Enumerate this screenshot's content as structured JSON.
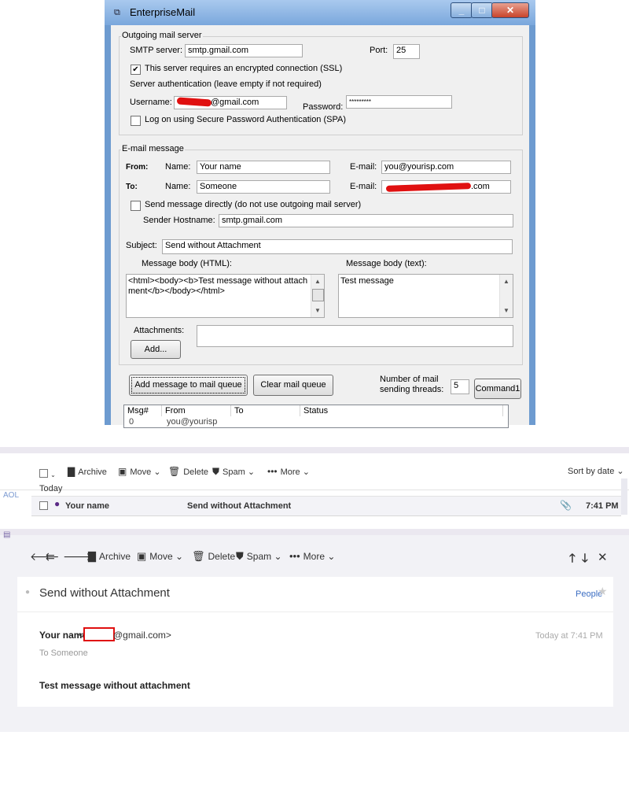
{
  "dialog": {
    "title": "EnterpriseMail",
    "outgoing": {
      "group_title": "Outgoing mail server",
      "smtp_label": "SMTP server:",
      "smtp_value": "smtp.gmail.com",
      "port_label": "Port:",
      "port_value": "25",
      "ssl_label": "This server requires an encrypted connection (SSL)",
      "ssl_checked": true,
      "auth_label": "Server authentication (leave empty if not required)",
      "username_label": "Username:",
      "username_value": "@gmail.com",
      "password_label": "Password:",
      "password_value": "*********",
      "spa_label": "Log on using Secure Password Authentication (SPA)"
    },
    "email": {
      "group_title": "E-mail message",
      "from_label": "From:",
      "to_label": "To:",
      "name_label": "Name:",
      "email_label": "E-mail:",
      "from_name": "Your name",
      "from_email": "you@yourisp.com",
      "to_name": "Someone",
      "to_email": ".com",
      "direct_label": "Send message directly (do not use outgoing mail server)",
      "hostname_label": "Sender Hostname:",
      "hostname_value": "smtp.gmail.com",
      "subject_label": "Subject:",
      "subject_value": "Send without Attachment",
      "html_body_label": "Message body (HTML):",
      "html_body_value": "<html><body><b>Test message without attachment</b></body></html>",
      "text_body_label": "Message body (text):",
      "text_body_value": "Test message",
      "attachments_label": "Attachments:",
      "add_button": "Add..."
    },
    "queue": {
      "add_button": "Add message to mail queue",
      "clear_button": "Clear mail queue",
      "threads_label_1": "Number of mail",
      "threads_label_2": "sending threads:",
      "threads_value": "5",
      "command_button": "Command1",
      "columns": [
        "Msg#",
        "From",
        "To",
        "Status"
      ],
      "row_partial": [
        "0",
        "you@yourisp"
      ]
    }
  },
  "mail_list": {
    "toolbar": {
      "archive": "Archive",
      "move": "Move",
      "delete": "Delete",
      "spam": "Spam",
      "more": "More",
      "sort": "Sort by date"
    },
    "side_label": "AOL",
    "group_label": "Today",
    "row": {
      "sender": "Your name",
      "subject": "Send without Attachment",
      "time": "7:41 PM"
    }
  },
  "message_view": {
    "toolbar": {
      "archive": "Archive",
      "move": "Move",
      "delete": "Delete",
      "spam": "Spam",
      "more": "More"
    },
    "subject": "Send without Attachment",
    "people_link": "People",
    "from_name": "Your name",
    "from_email_open": "<",
    "from_email_rest": "@gmail.com>",
    "to_line": "To  Someone",
    "date": "Today at 7:41 PM",
    "body": "Test message without attachment"
  },
  "colors": {
    "aero_frame": "#6d9bd0",
    "dialog_bg": "#f0f0f0",
    "redaction": "#e01010",
    "unread_dot": "#5b2a86",
    "people_link": "#3b6dc2"
  }
}
